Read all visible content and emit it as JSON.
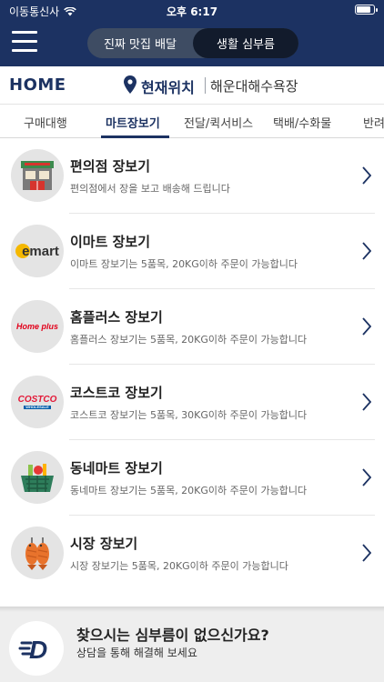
{
  "status_bar": {
    "carrier": "이동통신사",
    "time": "오후 6:17"
  },
  "header": {
    "segments": [
      {
        "label": "진짜 맛집 배달",
        "active": false
      },
      {
        "label": "생활 심부름",
        "active": true
      }
    ]
  },
  "location_bar": {
    "home_label": "HOME",
    "current_location_label": "현재위치",
    "address": "해운대해수욕장"
  },
  "tabs": [
    {
      "label": "구매대행",
      "active": false
    },
    {
      "label": "마트장보기",
      "active": true
    },
    {
      "label": "전달/퀵서비스",
      "active": false
    },
    {
      "label": "택배/수화물",
      "active": false
    },
    {
      "label": "반려",
      "active": false
    }
  ],
  "items": [
    {
      "title": "편의점 장보기",
      "desc": "편의점에서 장을 보고 배송해 드립니다",
      "icon": "convenience-store-icon"
    },
    {
      "title": "이마트 장보기",
      "desc": "이마트 장보기는 5품목, 20KG이하 주문이 가능합니다",
      "icon": "emart-logo",
      "logo_text": "emart"
    },
    {
      "title": "홈플러스 장보기",
      "desc": "홈플러스 장보기는 5품목, 20KG이하 주문이 가능합니다",
      "icon": "homeplus-logo",
      "logo_text": "Home plus"
    },
    {
      "title": "코스트코 장보기",
      "desc": "코스트코 장보기는 5품목, 30KG이하 주문이 가능합니다",
      "icon": "costco-logo",
      "logo_text": "COSTCO",
      "logo_sub": "WHOLESALE"
    },
    {
      "title": "동네마트 장보기",
      "desc": "동네마트 장보기는 5품목, 20KG이하 주문이 가능합니다",
      "icon": "grocery-basket-icon"
    },
    {
      "title": "시장 장보기",
      "desc": "시장 장보기는 5품목, 20KG이하 주문이 가능합니다",
      "icon": "fish-market-icon"
    }
  ],
  "footer": {
    "title": "찾으시는 심부름이 없으신가요?",
    "subtitle": "상담을 통해 해결해 보세요",
    "logo_letter": "D"
  },
  "colors": {
    "primary": "#1c3262",
    "emart_yellow": "#f5b800",
    "homeplus_red": "#e2001a",
    "costco_red": "#e31837",
    "costco_blue": "#005daa"
  }
}
